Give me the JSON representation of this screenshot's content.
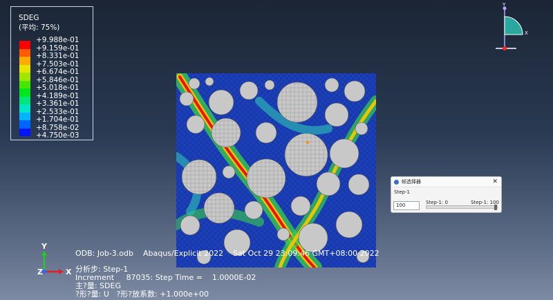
{
  "legend": {
    "title": "SDEG",
    "subtitle": "(平均: 75%)",
    "values": [
      "+9.988e-01",
      "+9.159e-01",
      "+8.331e-01",
      "+7.503e-01",
      "+6.674e-01",
      "+5.846e-01",
      "+5.018e-01",
      "+4.189e-01",
      "+3.361e-01",
      "+2.533e-01",
      "+1.704e-01",
      "+8.758e-02",
      "+4.750e-03"
    ],
    "colors": [
      "#ff0000",
      "#ff5a00",
      "#ffaa00",
      "#e6e600",
      "#a0e600",
      "#46e600",
      "#00e61e",
      "#00e678",
      "#00e6c8",
      "#00b4ff",
      "#0064ff",
      "#0014ff"
    ]
  },
  "info": {
    "odb": "ODB: Job-3.odb    Abaqus/Explicit 2022    Sat Oct 29 23:09:46 GMT+08:00 2022",
    "step": "分析步: Step-1",
    "increment": "Increment     87035: Step Time =    1.0000E-02",
    "primary": "主?量: SDEG",
    "deformed": "?形?量: U   ?形?放系数: +1.000e+00"
  },
  "triad": {
    "x": "X",
    "y": "Y",
    "z": "Z"
  },
  "dialog": {
    "title": "帧选择器",
    "step_label": "Step-1",
    "frame_value": "100",
    "min_label": "Step-1: 0",
    "max_label": "Step-1: 100",
    "slider_fraction": 1.0
  }
}
